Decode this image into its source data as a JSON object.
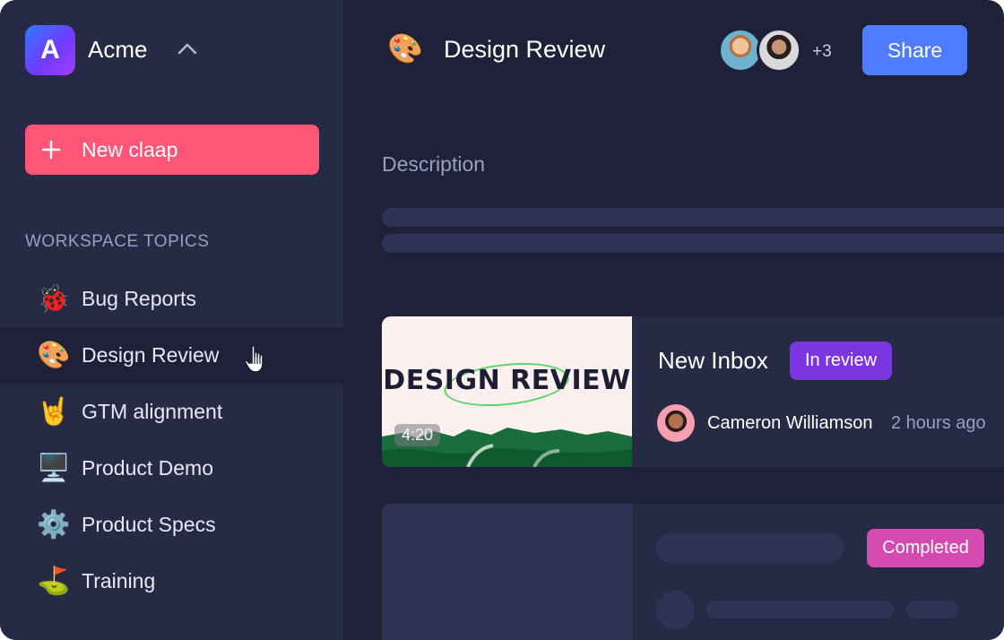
{
  "workspace": {
    "initial": "A",
    "name": "Acme"
  },
  "sidebar": {
    "new_button_label": "New claap",
    "section_title": "WORKSPACE TOPICS",
    "items": [
      {
        "emoji": "🐞",
        "label": "Bug Reports"
      },
      {
        "emoji": "🎨",
        "label": "Design Review",
        "active": true
      },
      {
        "emoji": "🤘",
        "label": "GTM alignment"
      },
      {
        "emoji": "🖥️",
        "label": "Product Demo"
      },
      {
        "emoji": "⚙️",
        "label": "Product Specs"
      },
      {
        "emoji": "⛳",
        "label": "Training"
      }
    ]
  },
  "header": {
    "topic_emoji": "🎨",
    "topic_title": "Design Review",
    "members_extra": "+3",
    "share_label": "Share"
  },
  "main": {
    "description_label": "Description",
    "cards": [
      {
        "thumbnail_text": "DESIGN REVIEW",
        "duration": "4:20",
        "title": "New Inbox",
        "status": "In review",
        "author": "Cameron Williamson",
        "time": "2 hours ago"
      },
      {
        "status": "Completed"
      }
    ]
  },
  "colors": {
    "accent_new": "#ff5577",
    "accent_share": "#4f7cff",
    "badge_review": "#7c36e0",
    "badge_completed": "#d34ab1"
  }
}
